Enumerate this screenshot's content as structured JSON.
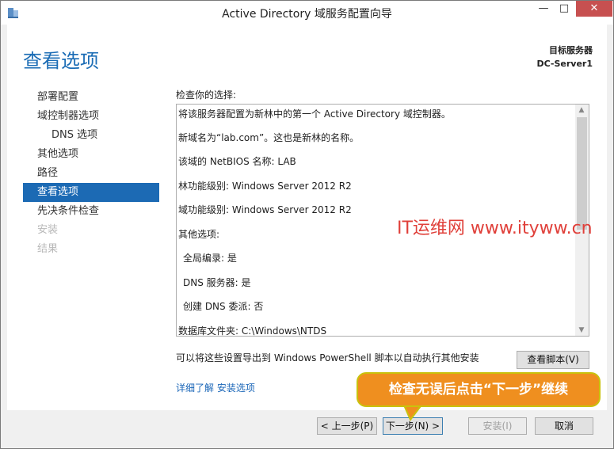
{
  "window": {
    "title": "Active Directory 域服务配置向导",
    "controls": [
      "—",
      "□",
      "✕"
    ]
  },
  "header": {
    "page_title": "查看选项",
    "target_label": "目标服务器",
    "target_server": "DC-Server1"
  },
  "nav": {
    "items": [
      {
        "label": "部署配置"
      },
      {
        "label": "域控制器选项"
      },
      {
        "label": "DNS 选项"
      },
      {
        "label": "其他选项"
      },
      {
        "label": "路径"
      },
      {
        "label": "查看选项"
      },
      {
        "label": "先决条件检查"
      },
      {
        "label": "安装"
      },
      {
        "label": "结果"
      }
    ]
  },
  "review": {
    "label": "检查你的选择:",
    "lines": [
      "将该服务器配置为新林中的第一个 Active Directory 域控制器。",
      "新域名为“lab.com”。这也是新林的名称。",
      "该域的 NetBIOS 名称: LAB",
      "林功能级别: Windows Server 2012 R2",
      "域功能级别: Windows Server 2012 R2",
      "其他选项:",
      "全局编录: 是",
      "DNS 服务器: 是",
      "创建 DNS 委派: 否",
      "数据库文件夹: C:\\Windows\\NTDS"
    ]
  },
  "watermark": "IT运维网 www.ityww.cn",
  "export": {
    "text": "可以将这些设置导出到 Windows PowerShell 脚本以自动执行其他安装",
    "button": "查看脚本(V)"
  },
  "link": "详细了解 安装选项",
  "footer": {
    "prev": "< 上一步(P)",
    "next": "下一步(N) >",
    "install": "安装(I)",
    "cancel": "取消"
  },
  "callout": "检查无误后点击“下一步”继续",
  "colors": {
    "accent": "#1c6ab4",
    "title_blue": "#1b6cb5",
    "close_red": "#c75050",
    "watermark_red": "#e0403a",
    "callout_orange": "#ef8f1f",
    "callout_border": "#c9c20d"
  }
}
